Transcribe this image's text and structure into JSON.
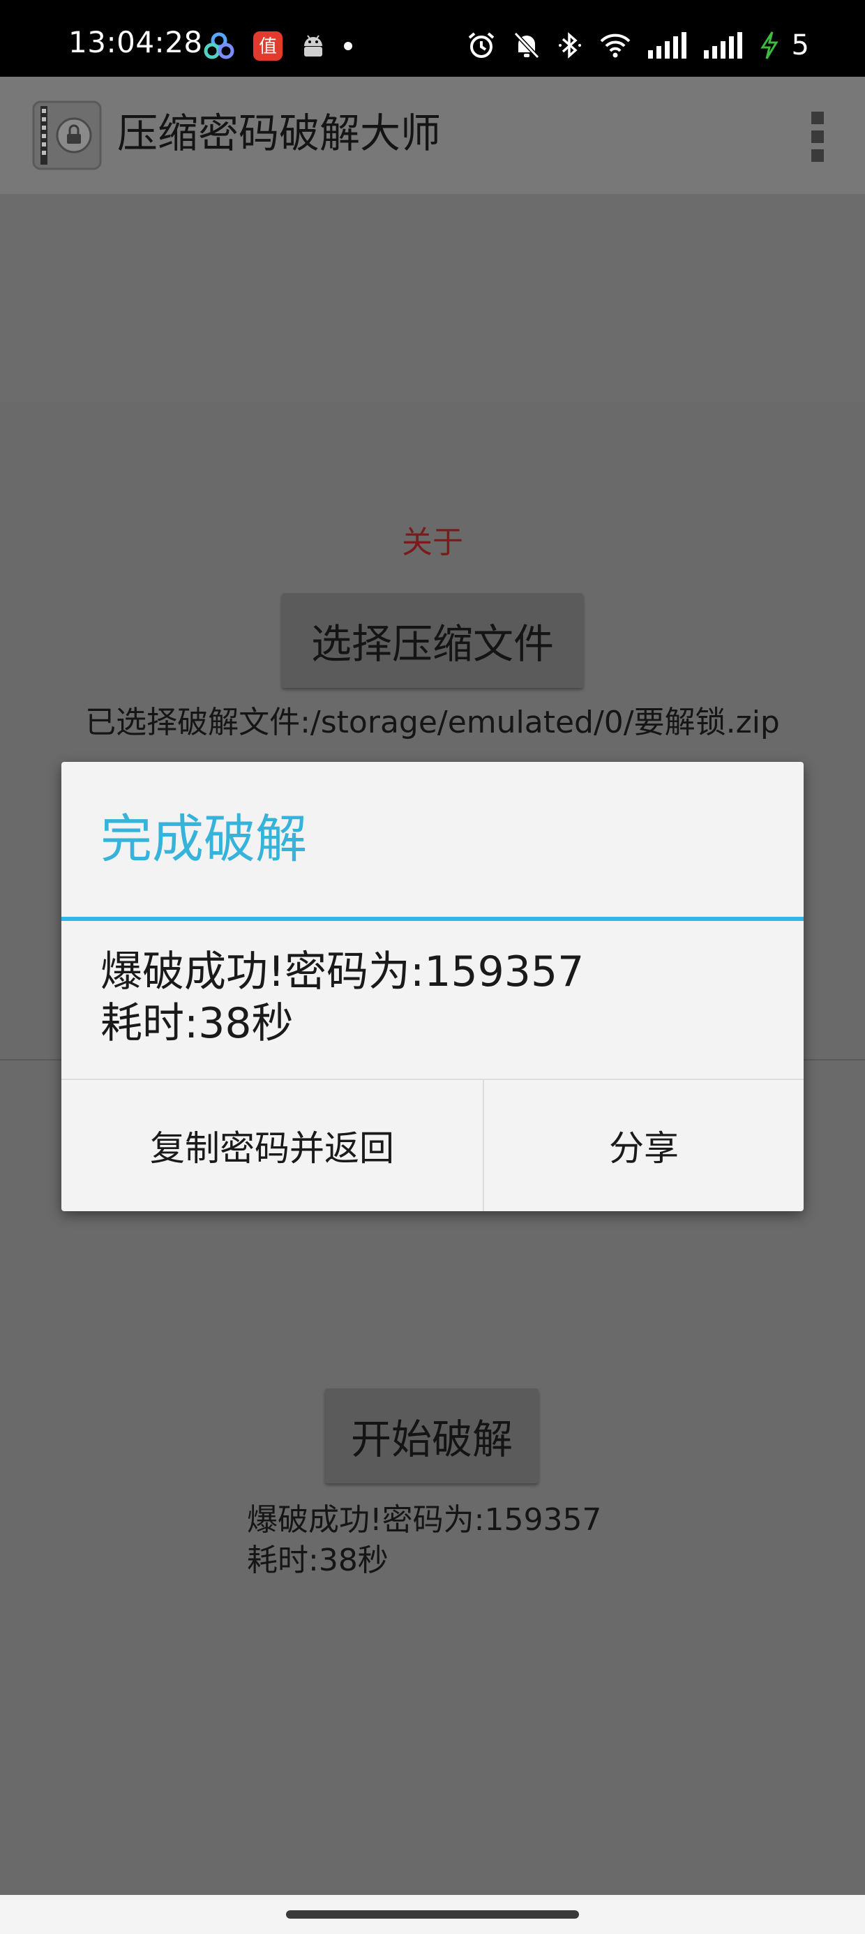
{
  "status_bar": {
    "time": "13:04:28",
    "left_icons": [
      "triple-ring-app-icon",
      "zhi-app-icon",
      "android-icon",
      "dot-icon"
    ],
    "right_icons": [
      "alarm-icon",
      "mute-icon",
      "bluetooth-icon",
      "wifi-icon",
      "signal-icon",
      "signal-icon",
      "charging-icon"
    ],
    "zhi_label": "值",
    "battery": "5",
    "charging_color": "#3dbb3d"
  },
  "app_bar": {
    "title": "压缩密码破解大师",
    "icons": [
      "app-icon",
      "overflow-menu-icon"
    ]
  },
  "main": {
    "about_link": "关于",
    "select_file_button": "选择压缩文件",
    "selected_file": "已选择破解文件:/storage/emulated/0/要解锁.zip",
    "start_button": "开始破解",
    "result_line1": "爆破成功!密码为:159357",
    "result_line2": "耗时:38秒"
  },
  "dialog": {
    "title": "完成破解",
    "message_line1": "爆破成功!密码为:159357",
    "message_line2": "耗时:38秒",
    "copy_button": "复制密码并返回",
    "share_button": "分享",
    "accent_color": "#33b5e5"
  }
}
